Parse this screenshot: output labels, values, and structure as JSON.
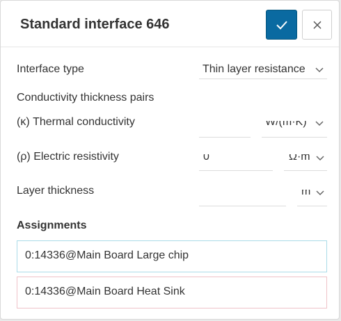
{
  "dialog": {
    "title": "Standard interface 646",
    "confirm_icon": "check-icon",
    "close_icon": "close-icon"
  },
  "interface_type": {
    "label": "Interface type",
    "value": "Thin layer resistance"
  },
  "conductivity_pairs": {
    "label": "Conductivity thickness pairs"
  },
  "thermal_conductivity": {
    "label": "(κ) Thermal conductivity",
    "value": "",
    "unit": "W/(m·K)"
  },
  "electric_resistivity": {
    "label": "(ρ) Electric resistivity",
    "value": "0",
    "unit": "Ω·m"
  },
  "layer_thickness": {
    "label": "Layer thickness",
    "value": "",
    "unit": "m"
  },
  "assignments": {
    "heading": "Assignments",
    "items": [
      {
        "label": "0:14336@Main Board Large chip"
      },
      {
        "label": "0:14336@Main Board Heat Sink"
      }
    ]
  },
  "colors": {
    "primary": "#0a6aa1",
    "assignment_1_border": "#a9dbe8",
    "assignment_2_border": "#efc2c8"
  }
}
